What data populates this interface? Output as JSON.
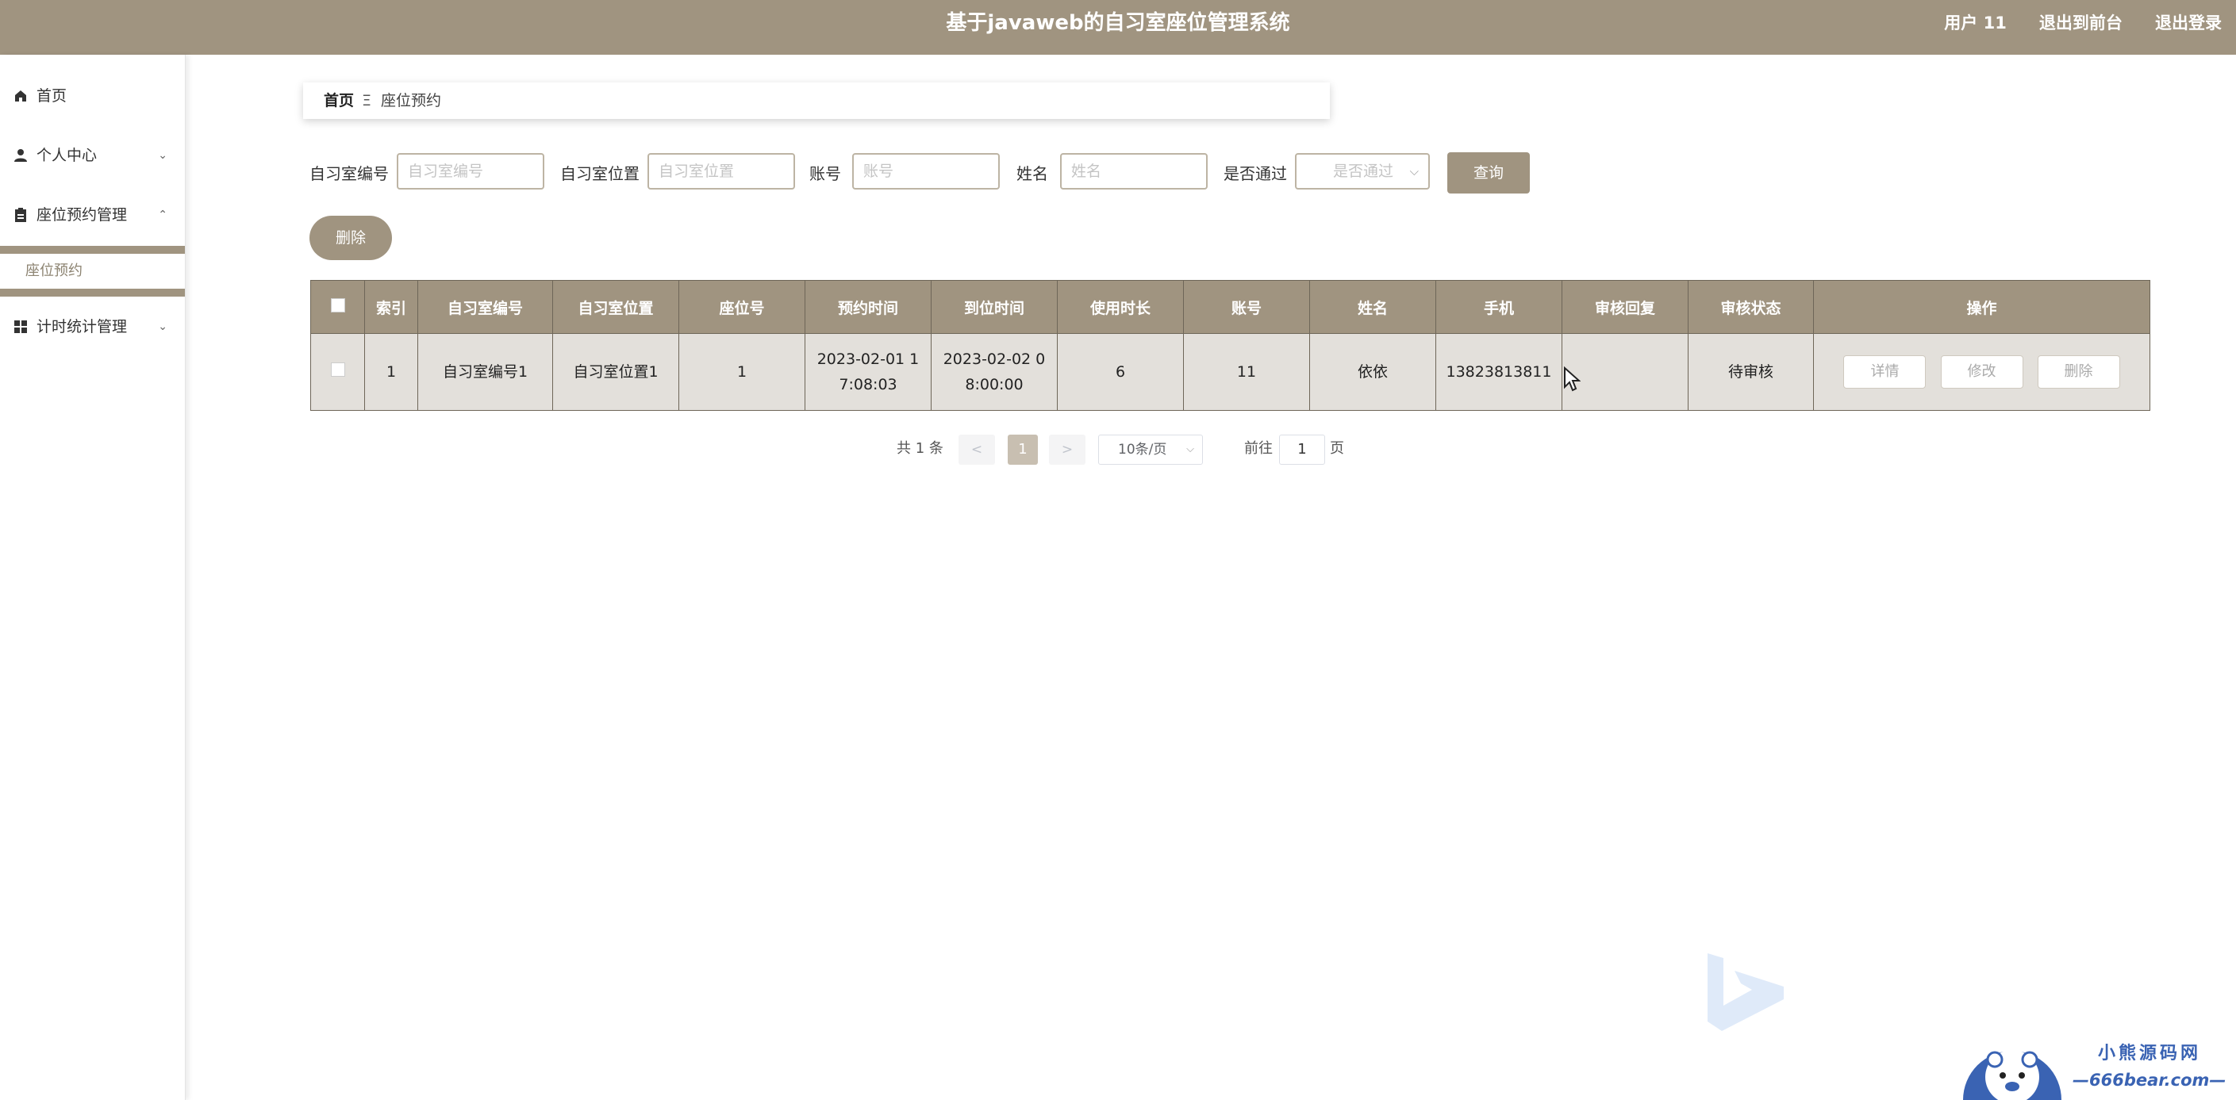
{
  "header": {
    "title": "基于javaweb的自习室座位管理系统",
    "user": "用户 11",
    "to_front": "退出到前台",
    "logout": "退出登录"
  },
  "sidebar": {
    "items": [
      {
        "label": "首页",
        "icon": "home-icon"
      },
      {
        "label": "个人中心",
        "icon": "user-icon",
        "chevron": "⌄"
      },
      {
        "label": "座位预约管理",
        "icon": "clipboard-icon",
        "chevron": "⌃"
      },
      {
        "label": "计时统计管理",
        "icon": "grid-icon",
        "chevron": "⌄"
      }
    ],
    "active_sub": "座位预约"
  },
  "breadcrumb": {
    "home": "首页",
    "separator": "Ξ",
    "current": "座位预约"
  },
  "filters": {
    "room_no_label": "自习室编号",
    "room_no_placeholder": "自习室编号",
    "room_loc_label": "自习室位置",
    "room_loc_placeholder": "自习室位置",
    "account_label": "账号",
    "account_placeholder": "账号",
    "name_label": "姓名",
    "name_placeholder": "姓名",
    "passed_label": "是否通过",
    "passed_placeholder": "是否通过",
    "query_button": "查询"
  },
  "actions": {
    "delete_button": "删除"
  },
  "table": {
    "headers": [
      "",
      "索引",
      "自习室编号",
      "自习室位置",
      "座位号",
      "预约时间",
      "到位时间",
      "使用时长",
      "账号",
      "姓名",
      "手机",
      "审核回复",
      "审核状态",
      "操作"
    ],
    "rows": [
      {
        "index": "1",
        "room_no": "自习室编号1",
        "room_loc": "自习室位置1",
        "seat": "1",
        "reserve_time": "2023-02-01 17:08:03",
        "arrive_time": "2023-02-02 08:00:00",
        "duration": "6",
        "account": "11",
        "name": "依依",
        "phone": "13823813811",
        "reply": "",
        "status": "待审核",
        "btn_detail": "详情",
        "btn_edit": "修改",
        "btn_delete": "删除"
      }
    ]
  },
  "pagination": {
    "total": "共 1 条",
    "prev": "<",
    "current": "1",
    "next": ">",
    "page_size": "10条/页",
    "goto_label": "前往",
    "goto_value": "1",
    "page_unit": "页"
  },
  "watermark": {
    "line1": "小熊源码网",
    "line2": "—666bear.com—"
  },
  "colors": {
    "primary": "#a09480",
    "row_bg": "#e3e0db"
  }
}
